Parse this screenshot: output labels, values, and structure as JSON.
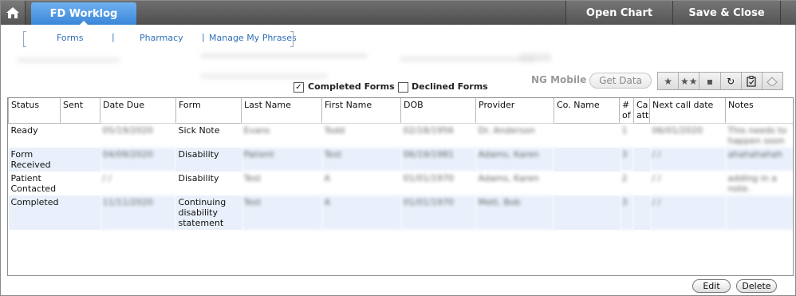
{
  "topbar": {
    "active_tab": "FD Worklog",
    "open_chart": "Open Chart",
    "save_close": "Save & Close"
  },
  "subnav": {
    "links": [
      "Forms",
      "Pharmacy",
      "Manage My Phrases"
    ],
    "sep": "|"
  },
  "filters": {
    "completed_label": "Completed Forms",
    "completed_checked": "✓",
    "declined_label": "Declined Forms"
  },
  "mobile": {
    "label": "NG Mobile",
    "get_data": "Get Data"
  },
  "toolbar": {
    "icons": [
      "star-icon",
      "stars-icon",
      "save-icon",
      "refresh-icon",
      "clipboard-check-icon",
      "eraser-icon"
    ]
  },
  "table": {
    "headers": [
      "Status",
      "Sent",
      "Date Due",
      "Form",
      "Last Name",
      "First Name",
      "DOB",
      "Provider",
      "Co. Name",
      "# of",
      "Ca att",
      "Next call date",
      "Notes"
    ],
    "rows": [
      {
        "status": "Ready",
        "sent": "",
        "date_due": "05/19/2020",
        "form": "Sick Note",
        "last": "Evans",
        "first": "Todd",
        "dob": "02/18/1956",
        "provider": "Dr. Anderson",
        "co": "",
        "num": "1",
        "ca": "",
        "next": "06/01/2020",
        "notes": "This needs to happen soon"
      },
      {
        "status": "Form Received",
        "sent": "",
        "date_due": "04/09/2020",
        "form": "Disability",
        "last": "Patient",
        "first": "Test",
        "dob": "06/19/1981",
        "provider": "Adams, Karen",
        "co": "",
        "num": "3",
        "ca": "",
        "next": "/ /",
        "notes": "ahahahahah"
      },
      {
        "status": "Patient Contacted",
        "sent": "",
        "date_due": "/ /",
        "form": "Disability",
        "last": "Test",
        "first": "A",
        "dob": "01/01/1970",
        "provider": "Adams, Karen",
        "co": "",
        "num": "2",
        "ca": "",
        "next": "/ /",
        "notes": "adding in a note."
      },
      {
        "status": "Completed",
        "sent": "",
        "date_due": "11/11/2020",
        "form": "Continuing disability statement",
        "last": "Test",
        "first": "A",
        "dob": "01/01/1970",
        "provider": "Mett, Bob",
        "co": "",
        "num": "3",
        "ca": "",
        "next": "/ /",
        "notes": ""
      }
    ]
  },
  "buttons": {
    "edit": "Edit",
    "delete": "Delete"
  },
  "colors": {
    "tab_blue": "#3a86d8",
    "link_blue": "#2f6fb7",
    "row_alt": "#e9f0fb"
  }
}
